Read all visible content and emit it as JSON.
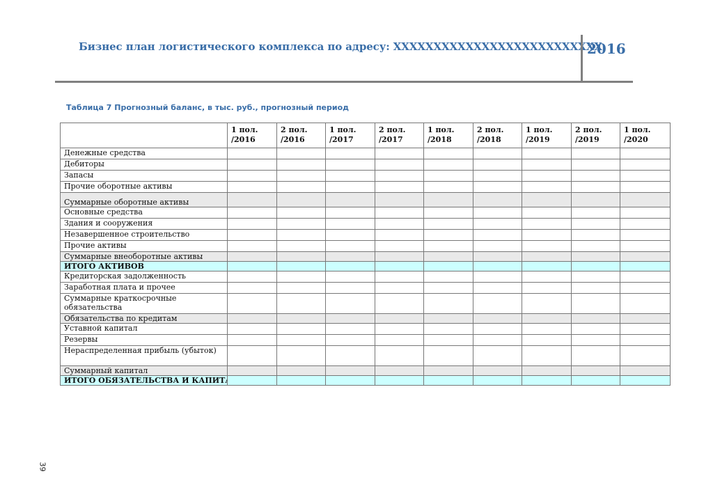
{
  "header": {
    "title": "Бизнес план логистического комплекса по адресу: ХХХХХХХХХХХХХХХХХХХХХХХХХХ",
    "year": "2016"
  },
  "caption": "Таблица 7 Прогнозный баланс, в тыс. руб., прогнозный период",
  "table": {
    "columns": [
      "1 пол. /2016",
      "2 пол. /2016",
      "1 пол. /2017",
      "2 пол. /2017",
      "1 пол. /2018",
      "2 пол. /2018",
      "1 пол. /2019",
      "2 пол. /2019",
      "1 пол. /2020"
    ],
    "rows": [
      {
        "label": "Денежные средства",
        "kind": "normal"
      },
      {
        "label": "Дебиторы",
        "kind": "normal"
      },
      {
        "label": "Запасы",
        "kind": "normal"
      },
      {
        "label": "Прочие оборотные активы",
        "kind": "normal"
      },
      {
        "label": "Суммарные оборотные активы",
        "kind": "sum"
      },
      {
        "label": "Основные средства",
        "kind": "normal"
      },
      {
        "label": "Здания и сооружения",
        "kind": "normal"
      },
      {
        "label": "Незавершенное строительство",
        "kind": "normal"
      },
      {
        "label": "Прочие активы",
        "kind": "normal"
      },
      {
        "label": "Суммарные внеоборотные активы",
        "kind": "sum"
      },
      {
        "label": "ИТОГО АКТИВОВ",
        "kind": "total"
      },
      {
        "label": "Кредиторская задолженность",
        "kind": "normal"
      },
      {
        "label": "Заработная плата и прочее",
        "kind": "normal"
      },
      {
        "label": "Суммарные краткосрочные обязательства",
        "kind": "normal"
      },
      {
        "label": "Обязательства по кредитам",
        "kind": "sum"
      },
      {
        "label": "Уставной капитал",
        "kind": "normal"
      },
      {
        "label": "Резервы",
        "kind": "normal"
      },
      {
        "label": "Нераспределенная прибыль (убыток)",
        "kind": "normal"
      },
      {
        "label": "Суммарный капитал",
        "kind": "sum"
      },
      {
        "label": "ИТОГО ОБЯЗАТЕЛЬСТВА И КАПИТАЛ",
        "kind": "total"
      }
    ]
  },
  "page_number": "39"
}
